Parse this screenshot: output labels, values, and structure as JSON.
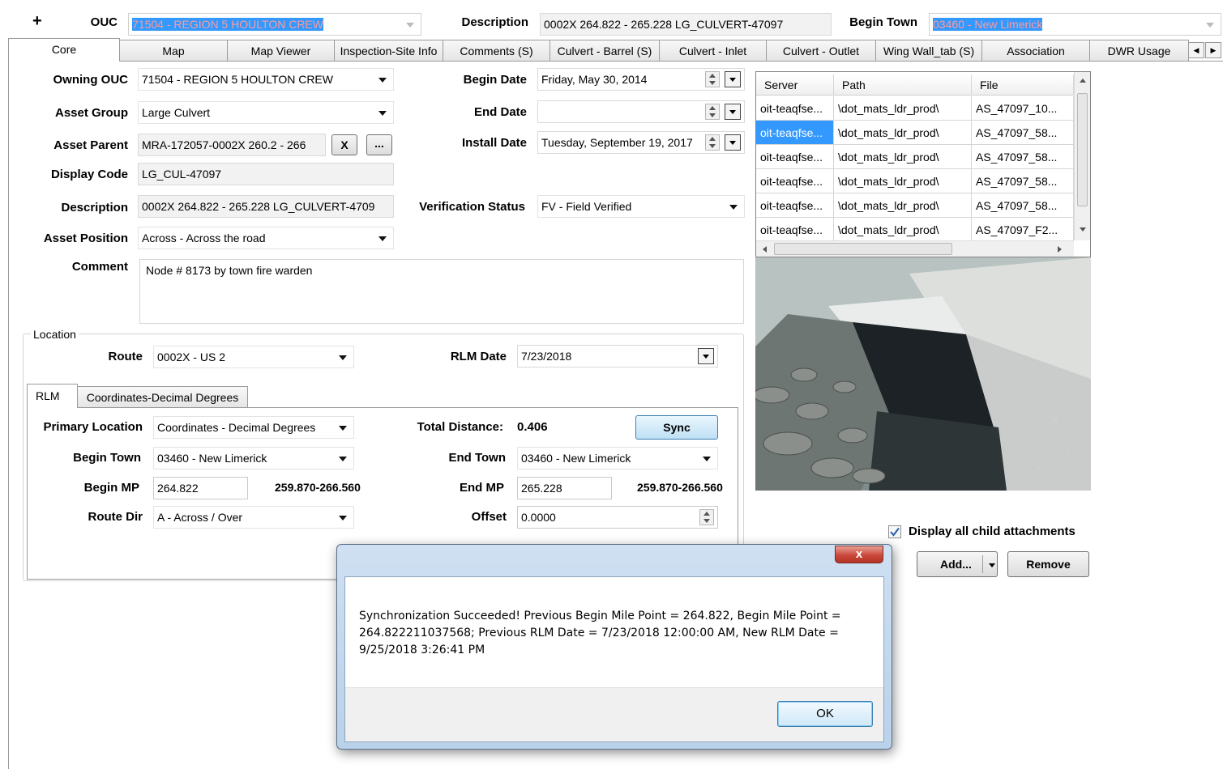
{
  "header": {
    "plus": "+",
    "ouc_label": "OUC",
    "ouc_value": "71504 - REGION 5 HOULTON CREW",
    "description_label": "Description",
    "description_value": "0002X 264.822  - 265.228 LG_CULVERT-47097",
    "begin_town_label": "Begin Town",
    "begin_town_value": "03460 - New Limerick"
  },
  "tabs": [
    {
      "label": "Core"
    },
    {
      "label": "Map"
    },
    {
      "label": "Map Viewer"
    },
    {
      "label": "Inspection-Site Info"
    },
    {
      "label": "Comments (S)"
    },
    {
      "label": "Culvert - Barrel (S)"
    },
    {
      "label": "Culvert - Inlet"
    },
    {
      "label": "Culvert - Outlet"
    },
    {
      "label": "Wing Wall_tab (S)"
    },
    {
      "label": "Association"
    },
    {
      "label": "DWR Usage"
    }
  ],
  "core": {
    "owning_ouc_label": "Owning OUC",
    "owning_ouc_value": "71504 - REGION 5 HOULTON CREW",
    "asset_group_label": "Asset Group",
    "asset_group_value": "Large Culvert",
    "asset_parent_label": "Asset Parent",
    "asset_parent_value": "MRA-172057-0002X 260.2  - 266",
    "asset_parent_clear": "X",
    "asset_parent_browse": "...",
    "display_code_label": "Display Code",
    "display_code_value": "LG_CUL-47097",
    "description_label": "Description",
    "description_value": "0002X 264.822  - 265.228 LG_CULVERT-4709",
    "asset_position_label": "Asset Position",
    "asset_position_value": "Across - Across the road",
    "comment_label": "Comment",
    "comment_value": "Node # 8173   by town fire warden",
    "begin_date_label": "Begin Date",
    "begin_date_value": "Friday, May 30, 2014",
    "end_date_label": "End Date",
    "end_date_value": "",
    "install_date_label": "Install Date",
    "install_date_value": "Tuesday, September 19, 2017",
    "verification_label": "Verification Status",
    "verification_value": "FV - Field Verified"
  },
  "location": {
    "group_label": "Location",
    "route_label": "Route",
    "route_value": "0002X - US 2",
    "rlm_date_label": "RLM Date",
    "rlm_date_value": "7/23/2018",
    "subtabs": [
      {
        "label": "RLM"
      },
      {
        "label": "Coordinates-Decimal Degrees"
      }
    ],
    "primary_location_label": "Primary Location",
    "primary_location_value": "Coordinates - Decimal Degrees",
    "total_distance_label": "Total Distance:",
    "total_distance_value": "0.406",
    "sync_label": "Sync",
    "begin_town_label": "Begin Town",
    "begin_town_value": "03460 - New Limerick",
    "end_town_label": "End Town",
    "end_town_value": "03460 - New Limerick",
    "begin_mp_label": "Begin MP",
    "begin_mp_value": "264.822",
    "begin_mp_range": "259.870-266.560",
    "end_mp_label": "End MP",
    "end_mp_value": "265.228",
    "end_mp_range": "259.870-266.560",
    "route_dir_label": "Route Dir",
    "route_dir_value": "A - Across / Over",
    "offset_label": "Offset",
    "offset_value": "0.0000"
  },
  "attachments": {
    "columns": [
      "Server",
      "Path",
      "File"
    ],
    "rows": [
      [
        "oit-teaqfse...",
        "\\dot_mats_ldr_prod\\",
        "AS_47097_10..."
      ],
      [
        "oit-teaqfse...",
        "\\dot_mats_ldr_prod\\",
        "AS_47097_58..."
      ],
      [
        "oit-teaqfse...",
        "\\dot_mats_ldr_prod\\",
        "AS_47097_58..."
      ],
      [
        "oit-teaqfse...",
        "\\dot_mats_ldr_prod\\",
        "AS_47097_58..."
      ],
      [
        "oit-teaqfse...",
        "\\dot_mats_ldr_prod\\",
        "AS_47097_58..."
      ],
      [
        "oit-teaqfse...",
        "\\dot_mats_ldr_prod\\",
        "AS_47097_F2..."
      ]
    ],
    "display_all_label": "Display all child attachments",
    "display_all_checked": true,
    "add_label": "Add...",
    "remove_label": "Remove",
    "photo_icon": "culvert-photo"
  },
  "dialog": {
    "message": "Synchronization Succeeded!  Previous Begin Mile Point = 264.822, Begin Mile Point = 264.822211037568; Previous RLM Date = 7/23/2018 12:00:00 AM, New RLM Date = 9/25/2018 3:26:41 PM",
    "close_label": "x",
    "ok_label": "OK"
  },
  "colors": {
    "selection": "#3399ff",
    "dialog_close": "#c9483b",
    "dialog_frame": "#b9d1ea"
  }
}
